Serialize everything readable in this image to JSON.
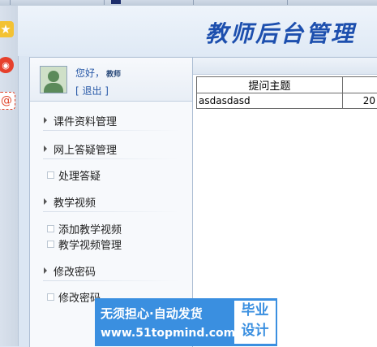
{
  "banner": {
    "title": "教师后台管理"
  },
  "user": {
    "greeting": "您好，",
    "name": "教师",
    "logout": "[ 退出 ]"
  },
  "menu": [
    {
      "type": "section",
      "label": "课件资料管理"
    },
    {
      "type": "section",
      "label": "网上答疑管理"
    },
    {
      "type": "link",
      "label": "处理答疑"
    },
    {
      "type": "section",
      "label": "教学视频"
    },
    {
      "type": "link",
      "label": "添加教学视频"
    },
    {
      "type": "link",
      "label": "教学视频管理"
    },
    {
      "type": "section",
      "label": "修改密码"
    },
    {
      "type": "link",
      "label": "修改密码"
    }
  ],
  "table": {
    "headers": [
      "提问主题",
      ""
    ],
    "rows": [
      [
        "asdasdasd",
        "20"
      ]
    ]
  },
  "ad": {
    "line1": "无须担心·自动发货",
    "line2": "www.51topmind.com",
    "box1": "毕业",
    "box2": "设计"
  },
  "colors": {
    "accent": "#1d4fae",
    "ad": "#3a8fe0"
  }
}
